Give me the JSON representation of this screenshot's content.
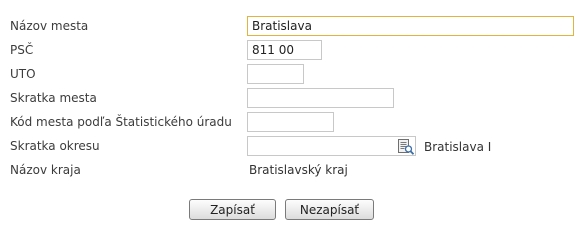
{
  "form": {
    "nazov_mesta": {
      "label": "Názov mesta",
      "value": "Bratislava"
    },
    "psc": {
      "label": "PSČ",
      "value": "811 00"
    },
    "uto": {
      "label": "UTO",
      "value": ""
    },
    "skratka_mesta": {
      "label": "Skratka mesta",
      "value": ""
    },
    "kod_mesta": {
      "label": "Kód mesta podľa Štatistického úradu",
      "value": ""
    },
    "skratka_okresu": {
      "label": "Skratka okresu",
      "value": "",
      "lookup_text": "Bratislava I",
      "picker_icon": "document-lookup-icon"
    },
    "nazov_kraja": {
      "label": "Názov kraja",
      "value": "Bratislavský kraj"
    }
  },
  "buttons": {
    "save": "Zapísať",
    "cancel": "Nezapísať"
  },
  "colors": {
    "focus_border": "#e3b341",
    "input_border": "#c8c8c8"
  }
}
